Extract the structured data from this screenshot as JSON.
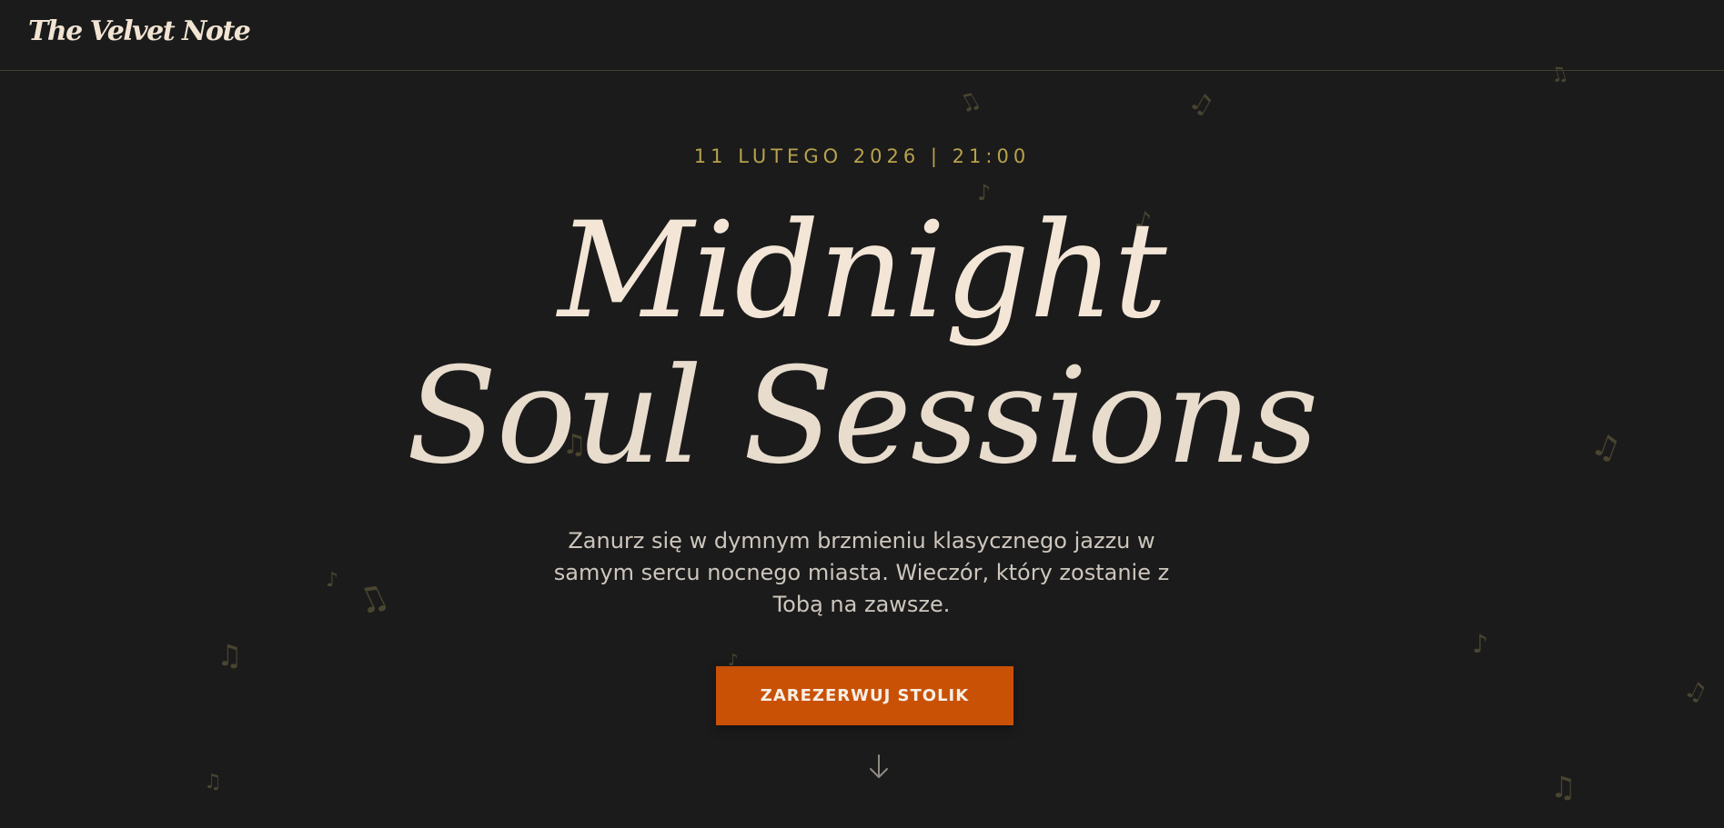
{
  "header": {
    "logo": "The Velvet Note"
  },
  "hero": {
    "date": "11 LUTEGO 2026 | 21:00",
    "title_line1": "Midnight",
    "title_line2": "Soul Sessions",
    "subtitle_line1": "Zanurz się w dymnym brzmieniu klasycznego jazzu w",
    "subtitle_line2": "samym sercu nocnego miasta. Wieczór, który zostanie z",
    "subtitle_line3": "Tobą na zawsze.",
    "cta_label": "ZAREZERWUJ STOLIK"
  },
  "icons": {
    "scroll": "arrow-down-icon",
    "decoration": "music-note-icon"
  },
  "colors": {
    "background": "#1b1b1c",
    "accent_gold": "#b8a24b",
    "cta_orange": "#c95106",
    "headline_cream": "#f4e6d6"
  }
}
